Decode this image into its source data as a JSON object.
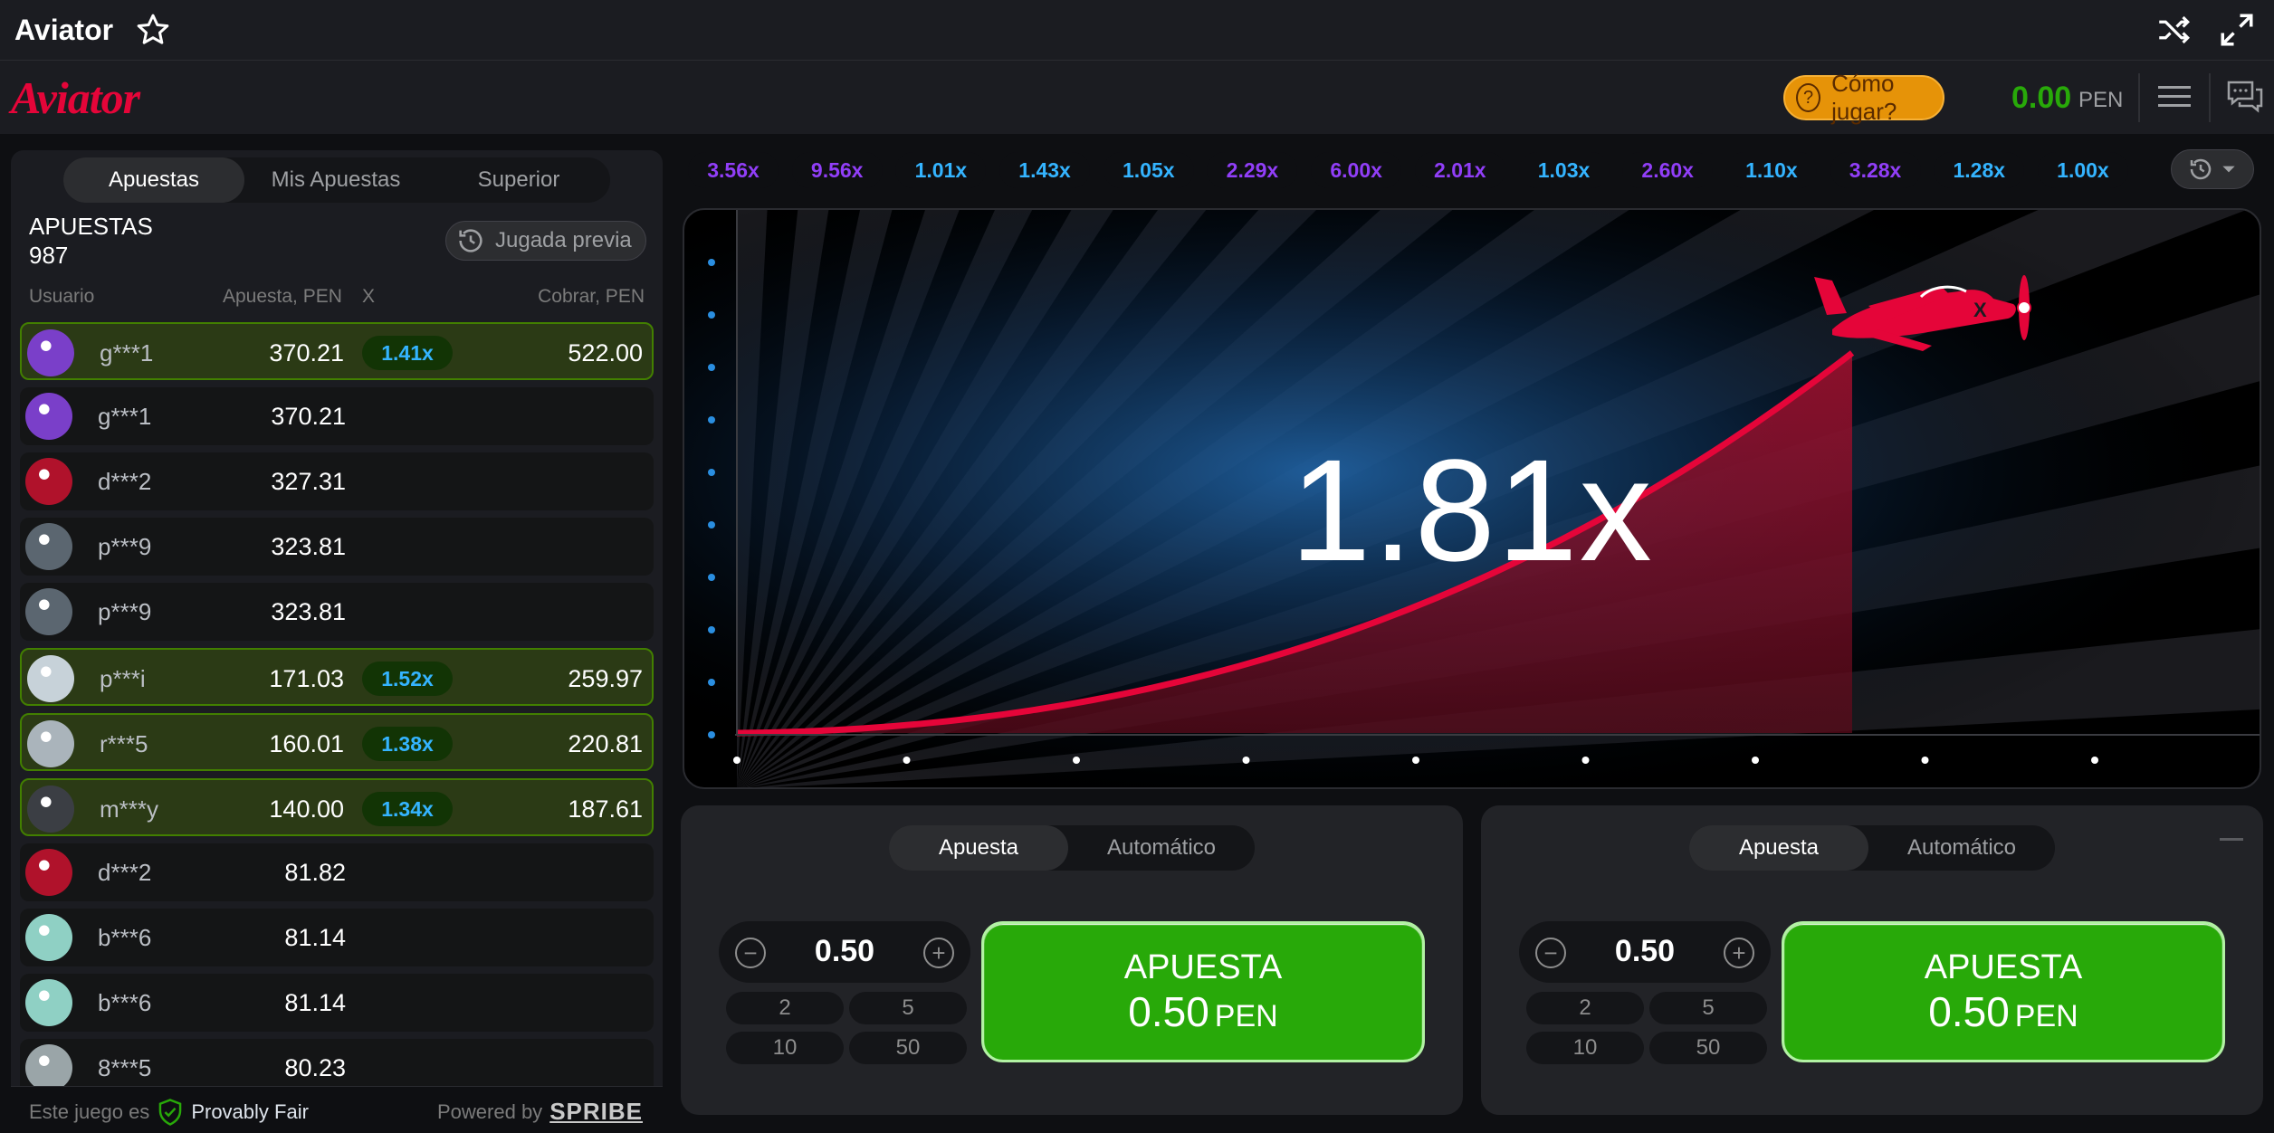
{
  "titlebar": {
    "title": "Aviator"
  },
  "header": {
    "logo": "Aviator",
    "howto_label": "Cómo jugar?",
    "balance": "0.00",
    "currency": "PEN"
  },
  "left": {
    "tabs": [
      "Apuestas",
      "Mis Apuestas",
      "Superior"
    ],
    "bets_label": "APUESTAS",
    "bets_count": "987",
    "prev_label": "Jugada previa",
    "columns": {
      "user": "Usuario",
      "bet": "Apuesta, PEN",
      "x": "X",
      "cashout": "Cobrar, PEN"
    },
    "rows": [
      {
        "user": "g***1",
        "bet": "370.21",
        "mult": "1.41x",
        "cash": "522.00"
      },
      {
        "user": "g***1",
        "bet": "370.21",
        "mult": "",
        "cash": ""
      },
      {
        "user": "d***2",
        "bet": "327.31",
        "mult": "",
        "cash": ""
      },
      {
        "user": "p***9",
        "bet": "323.81",
        "mult": "",
        "cash": ""
      },
      {
        "user": "p***9",
        "bet": "323.81",
        "mult": "",
        "cash": ""
      },
      {
        "user": "p***i",
        "bet": "171.03",
        "mult": "1.52x",
        "cash": "259.97"
      },
      {
        "user": "r***5",
        "bet": "160.01",
        "mult": "1.38x",
        "cash": "220.81"
      },
      {
        "user": "m***y",
        "bet": "140.00",
        "mult": "1.34x",
        "cash": "187.61"
      },
      {
        "user": "d***2",
        "bet": "81.82",
        "mult": "",
        "cash": ""
      },
      {
        "user": "b***6",
        "bet": "81.14",
        "mult": "",
        "cash": ""
      },
      {
        "user": "b***6",
        "bet": "81.14",
        "mult": "",
        "cash": ""
      },
      {
        "user": "8***5",
        "bet": "80.23",
        "mult": "",
        "cash": ""
      }
    ],
    "footer": {
      "prefix": "Este juego es",
      "fair": "Provably Fair",
      "powered": "Powered by",
      "brand": "SPRIBE"
    }
  },
  "history": [
    {
      "v": "3.56x",
      "c": "#913ef8"
    },
    {
      "v": "9.56x",
      "c": "#913ef8"
    },
    {
      "v": "1.01x",
      "c": "#34b4ff"
    },
    {
      "v": "1.43x",
      "c": "#34b4ff"
    },
    {
      "v": "1.05x",
      "c": "#34b4ff"
    },
    {
      "v": "2.29x",
      "c": "#913ef8"
    },
    {
      "v": "6.00x",
      "c": "#913ef8"
    },
    {
      "v": "2.01x",
      "c": "#913ef8"
    },
    {
      "v": "1.03x",
      "c": "#34b4ff"
    },
    {
      "v": "2.60x",
      "c": "#913ef8"
    },
    {
      "v": "1.10x",
      "c": "#34b4ff"
    },
    {
      "v": "3.28x",
      "c": "#913ef8"
    },
    {
      "v": "1.28x",
      "c": "#34b4ff"
    },
    {
      "v": "1.00x",
      "c": "#34b4ff"
    }
  ],
  "game": {
    "multiplier": "1.81x"
  },
  "betpanels": [
    {
      "tabs": [
        "Apuesta",
        "Automático"
      ],
      "amount": "0.50",
      "quick": [
        "2",
        "5",
        "10",
        "50"
      ],
      "btn_line1": "APUESTA",
      "btn_amount": "0.50",
      "btn_currency": "PEN"
    },
    {
      "tabs": [
        "Apuesta",
        "Automático"
      ],
      "amount": "0.50",
      "quick": [
        "2",
        "5",
        "10",
        "50"
      ],
      "btn_line1": "APUESTA",
      "btn_amount": "0.50",
      "btn_currency": "PEN"
    }
  ],
  "colors": {
    "accent_red": "#e50539",
    "green": "#28a909",
    "blue_mult": "#34b4ff",
    "purple_mult": "#913ef8",
    "orange": "#e69308"
  }
}
